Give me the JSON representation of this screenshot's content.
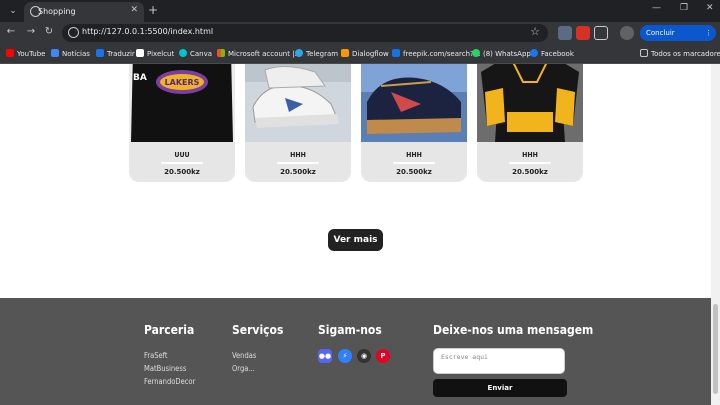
{
  "browser": {
    "tab_title": "Shopping",
    "url": "http://127.0.0.1:5500/index.html",
    "update_label": "Concluir atualização",
    "bookmarks": [
      "YouTube",
      "Notícias",
      "Traduzir",
      "Pixelcut",
      "Canva",
      "Microsoft account |...",
      "Telegram",
      "Dialogflow",
      "freepik.com/search?...",
      "(8) WhatsApp",
      "Facebook"
    ],
    "all_bookmarks": "Todos os marcadores"
  },
  "products": [
    {
      "name": "UUU",
      "price": "20.500kz",
      "image": "lakers-tshirt"
    },
    {
      "name": "HHH",
      "price": "20.500kz",
      "image": "white-sneakers"
    },
    {
      "name": "HHH",
      "price": "20.500kz",
      "image": "navy-sneaker"
    },
    {
      "name": "HHH",
      "price": "20.500kz",
      "image": "black-yellow-hoodie"
    }
  ],
  "more_button": "Ver mais",
  "footer": {
    "parceria": {
      "title": "Parceria",
      "links": [
        "FraSeft",
        "MatBusiness",
        "FernandoDecor"
      ]
    },
    "servicos": {
      "title": "Serviços",
      "links": [
        "Vendas",
        "Orga..."
      ]
    },
    "sigam": {
      "title": "Sigam-nos",
      "icons": [
        "discord-icon",
        "messenger-icon",
        "github-icon",
        "pinterest-icon"
      ]
    },
    "mensagem": {
      "title": "Deixe-nos uma mensagem",
      "placeholder": "Escreve aqui",
      "send_label": "Enviar"
    }
  },
  "colors": {
    "footer_bg": "#555555",
    "button_dark": "#222222",
    "card_bg": "#e6e6e6"
  }
}
